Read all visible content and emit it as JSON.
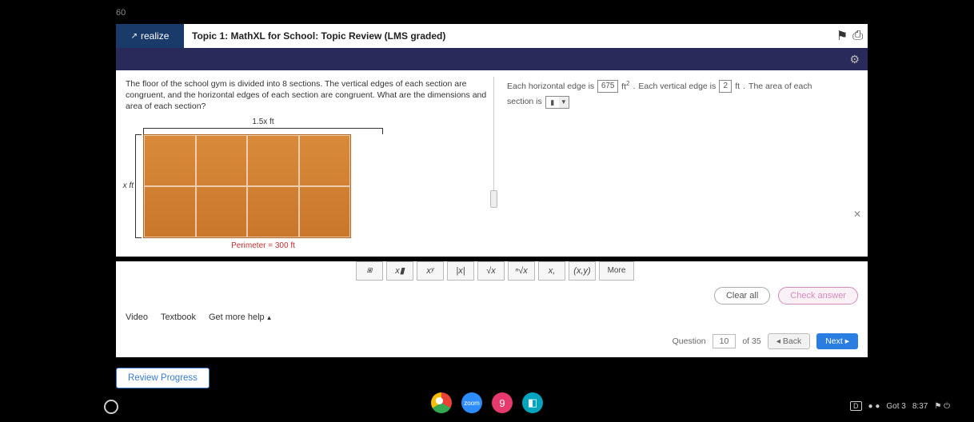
{
  "taskband": "60",
  "brand": {
    "icon": "↗",
    "text": "realize"
  },
  "header": {
    "title": "Topic 1: MathXL for School: Topic Review (LMS graded)"
  },
  "question": {
    "text": "The floor of the school gym is divided into 8 sections. The vertical edges of each section are congruent, and the horizontal edges of each section are congruent. What are the dimensions and area of each section?",
    "top_label": "1.5x ft",
    "left_label": "x ft",
    "perimeter": "Perimeter = 300 ft"
  },
  "answer": {
    "part1a": "Each horizontal edge is",
    "val1": "675",
    "unit1": "ft",
    "unit1_sup": "2",
    "sep": ".",
    "part1b": "Each vertical edge is",
    "val2": "2",
    "unit2": "ft",
    "part2": "The area of each",
    "part3": "section is",
    "dd_arrow": "▼"
  },
  "mathbar": {
    "b0": "⧆",
    "b1": "x▮",
    "b2": "xʸ",
    "b3": "|x|",
    "b4": "√x",
    "b5": "ⁿ√x",
    "b6": "x,",
    "b7": "(x,y)",
    "more": "More"
  },
  "actions": {
    "clear": "Clear all",
    "check": "Check answer"
  },
  "help": {
    "video": "Video",
    "textbook": "Textbook",
    "more": "Get more help",
    "caret": "▲"
  },
  "nav": {
    "label": "Question",
    "num": "10",
    "of": "of 35",
    "back": "◂ Back",
    "next": "Next ▸"
  },
  "review": "Review Progress",
  "tray": {
    "batt": "D",
    "dots": "● ●",
    "pct": "Got 3",
    "time": "8:37",
    "icons": "⚑ ⏻"
  }
}
